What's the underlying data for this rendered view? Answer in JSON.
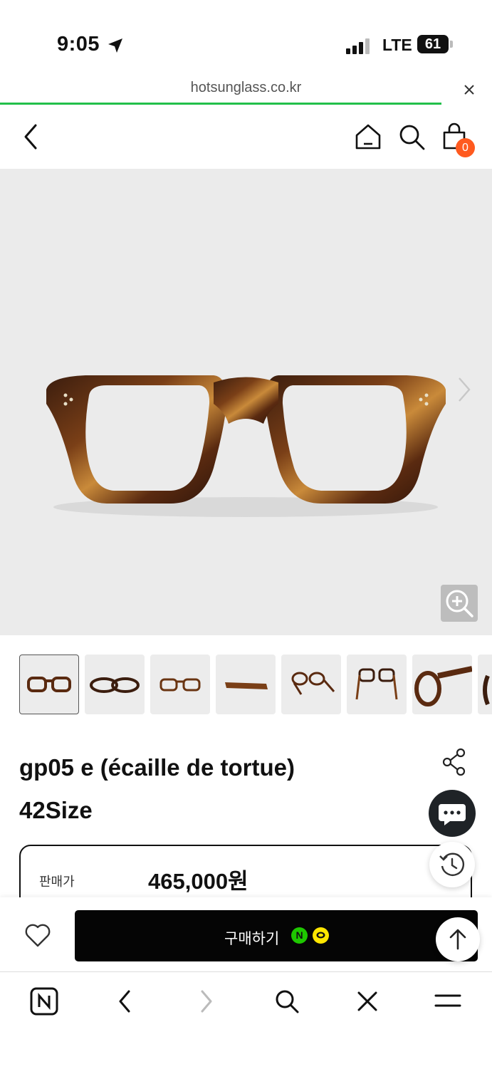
{
  "status_bar": {
    "time": "9:05",
    "network": "LTE",
    "battery": "61"
  },
  "browser": {
    "url": "hotsunglass.co.kr"
  },
  "header": {
    "cart_count": "0"
  },
  "product": {
    "name_line1": "gp05 e (écaille de tortue)",
    "name_line2": "42Size",
    "price_label": "판매가",
    "price_value": "465,000원"
  },
  "buy_bar": {
    "buy_label": "구매하기",
    "npay_label": "N"
  },
  "colors": {
    "progress": "#22c04a",
    "cart_badge": "#ff5a1f",
    "npay": "#1ec800",
    "kakaopay": "#ffe600"
  },
  "icons": [
    "location-arrow-icon",
    "close-icon",
    "back-icon",
    "home-icon",
    "search-icon",
    "cart-icon",
    "chevron-right-icon",
    "zoom-in-icon",
    "share-icon",
    "chat-icon",
    "history-icon",
    "heart-icon",
    "arrow-up-icon",
    "naver-icon",
    "forward-icon",
    "menu-icon"
  ]
}
